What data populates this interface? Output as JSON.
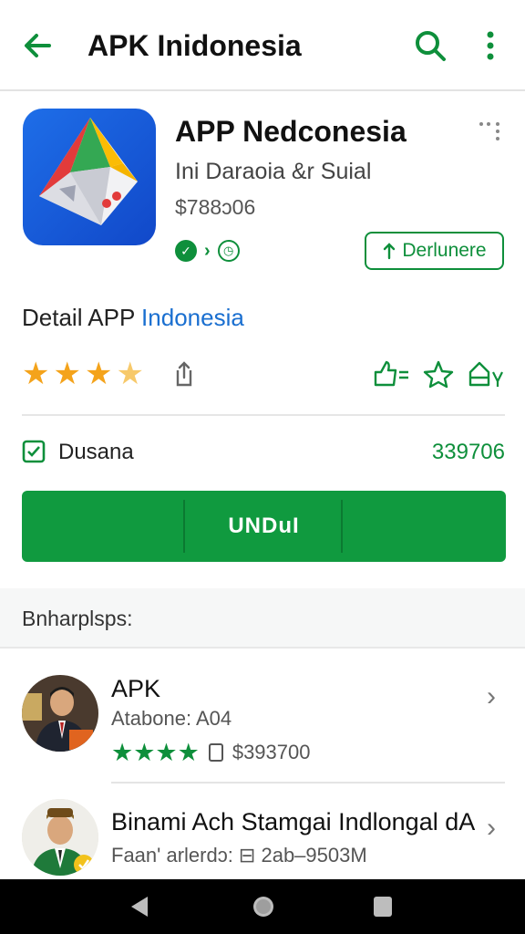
{
  "header": {
    "title": "APK Inidonesia",
    "back_icon": "arrow-left-icon",
    "search_icon": "search-icon",
    "more_icon": "more-vertical-icon",
    "accent": "#0e8f3b"
  },
  "app": {
    "name": "APP Nedconesia",
    "developer": "Ini Daraoia &r Suial",
    "price": "$788ɔ06",
    "install_label": "Derlunere"
  },
  "detail": {
    "title_prefix": "Detail APP ",
    "title_accent": "Indonesia",
    "rating_stars": 3.5
  },
  "info": {
    "label": "Dusana",
    "value": "339706"
  },
  "download": {
    "label": "UNDuI"
  },
  "section": {
    "title": "Bnharplsps:"
  },
  "list": [
    {
      "title": "APK",
      "subtitle": "Atabone: A04",
      "rating_stars": 4,
      "meta": "$393700"
    },
    {
      "title": "Binami Ach Stamgai Indlongal dA",
      "subtitle": "Faan' arlerdɔ: ⊟ 2ab–9503M"
    }
  ],
  "navbar": {
    "back_icon": "nav-back-icon",
    "home_icon": "nav-home-icon",
    "recent_icon": "nav-recent-icon"
  }
}
